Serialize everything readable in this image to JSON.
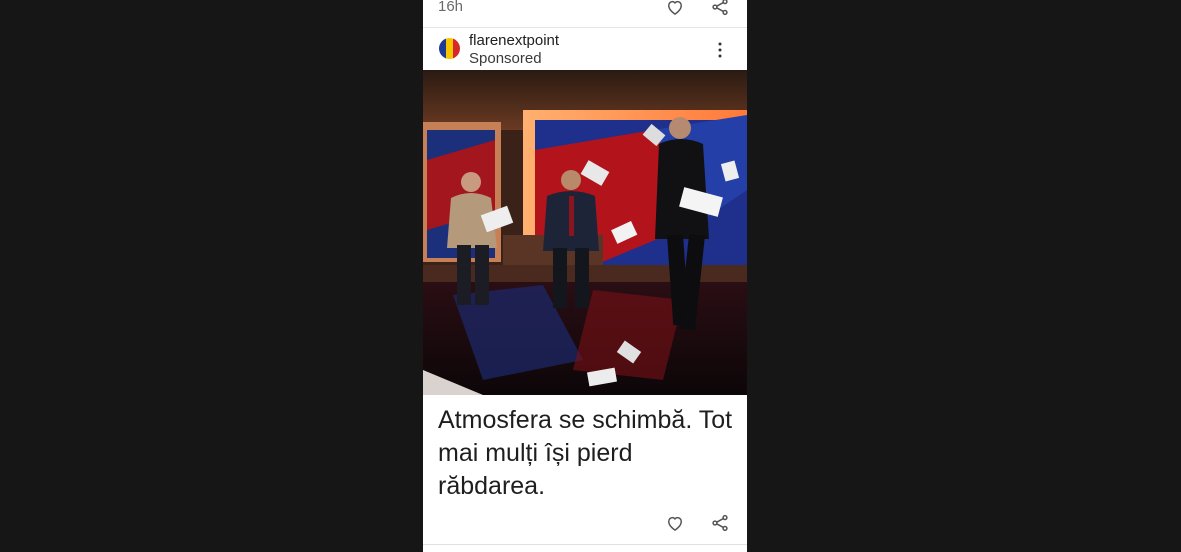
{
  "previous_post": {
    "time": "16h",
    "like_icon": "heart-icon",
    "share_icon": "share-icon"
  },
  "post": {
    "author": "flarenextpoint",
    "label": "Sponsored",
    "avatar_colors": [
      "#1f3a93",
      "#f7c600",
      "#d62828"
    ],
    "menu_icon": "more-vertical-icon",
    "image_alt": "TV studio debate: three men, one walking away while papers fly",
    "caption": "Atmosfera se schimbă. Tot mai mulți își pierd răbdarea.",
    "like_icon": "heart-icon",
    "share_icon": "share-icon"
  },
  "colors": {
    "page_background": "#161616",
    "card_background": "#ffffff",
    "text_primary": "#1e1e1e",
    "text_secondary": "#6b6b6b"
  }
}
